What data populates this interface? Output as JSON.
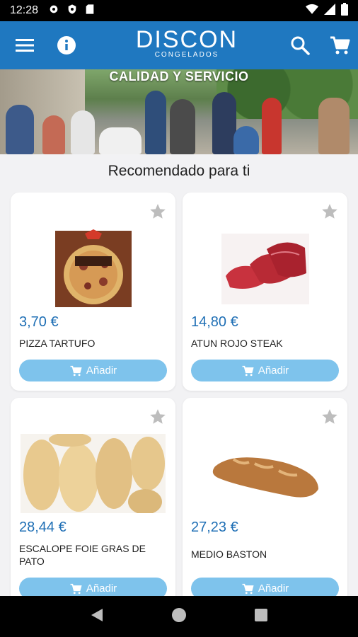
{
  "status_bar": {
    "time": "12:28"
  },
  "app_bar": {
    "logo_main": "DISCON",
    "logo_sub": "CONGELADOS",
    "menu_icon": "menu-icon",
    "info_icon": "info-icon",
    "search_icon": "search-icon",
    "cart_icon": "cart-icon"
  },
  "banner": {
    "text": "CALIDAD Y SERVICIO"
  },
  "section": {
    "title": "Recomendado para ti"
  },
  "products": [
    {
      "price": "3,70 €",
      "name": "PIZZA TARTUFO",
      "add_label": "Añadir",
      "image": "pizza-box"
    },
    {
      "price": "14,80 €",
      "name": "ATUN ROJO STEAK",
      "add_label": "Añadir",
      "image": "tuna-steak"
    },
    {
      "price": "28,44 €",
      "name": "ESCALOPE FOIE GRAS DE PATO",
      "add_label": "Añadir",
      "image": "foie-gras"
    },
    {
      "price": "27,23 €",
      "name": "MEDIO BASTON",
      "add_label": "Añadir",
      "image": "baguette"
    }
  ],
  "colors": {
    "primary": "#1f78c0",
    "price": "#1f6fb5",
    "button": "#7ec3ec",
    "background": "#f2f2f4"
  }
}
